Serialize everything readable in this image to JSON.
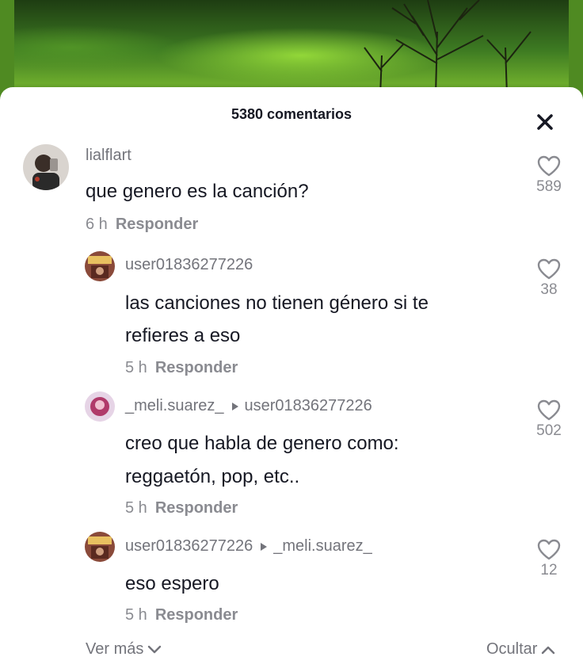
{
  "header": {
    "title": "5380 comentarios"
  },
  "comments": [
    {
      "username": "lialflart",
      "text": "que genero es la canción?",
      "time": "6 h",
      "reply_label": "Responder",
      "likes": "589"
    },
    {
      "username": "user01836277226",
      "text_line1": "las canciones no tienen género si te",
      "text_line2": "refieres a eso",
      "time": "5 h",
      "reply_label": "Responder",
      "likes": "38"
    },
    {
      "username": "_meli.suarez_",
      "reply_to": "user01836277226",
      "text_line1": "creo que habla de genero como:",
      "text_line2": "reggaetón, pop, etc..",
      "time": "5 h",
      "reply_label": "Responder",
      "likes": "502"
    },
    {
      "username": "user01836277226",
      "reply_to": "_meli.suarez_",
      "text": "eso espero",
      "time": "5 h",
      "reply_label": "Responder",
      "likes": "12"
    }
  ],
  "footer": {
    "view_more": "Ver más",
    "hide": "Ocultar"
  },
  "icons": [
    "close-icon",
    "heart-icon",
    "reply-arrow-icon",
    "chevron-down-icon",
    "chevron-up-icon"
  ]
}
